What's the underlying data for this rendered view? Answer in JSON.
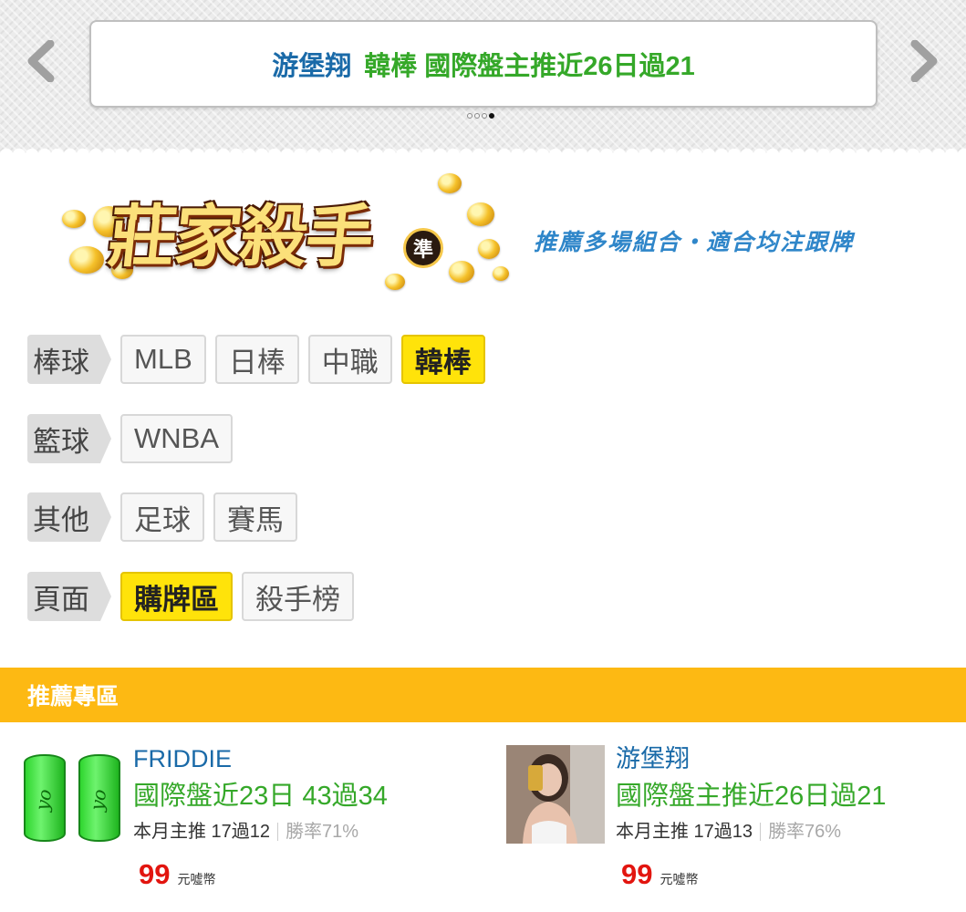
{
  "carousel": {
    "prev_icon": "chevron-left-icon",
    "next_icon": "chevron-right-icon",
    "banner_name": "游堡翔",
    "banner_text": "韓棒 國際盤主推近26日過21",
    "dot_count": 4,
    "active_dot": 3
  },
  "logo": {
    "title": "莊家殺手",
    "badge": "準",
    "tagline": "推薦多場組合・適合均注跟牌"
  },
  "categories": [
    {
      "label": "棒球",
      "items": [
        {
          "text": "MLB",
          "active": false
        },
        {
          "text": "日棒",
          "active": false
        },
        {
          "text": "中職",
          "active": false
        },
        {
          "text": "韓棒",
          "active": true
        }
      ]
    },
    {
      "label": "籃球",
      "items": [
        {
          "text": "WNBA",
          "active": false
        }
      ]
    },
    {
      "label": "其他",
      "items": [
        {
          "text": "足球",
          "active": false
        },
        {
          "text": "賽馬",
          "active": false
        }
      ]
    },
    {
      "label": "頁面",
      "items": [
        {
          "text": "購牌區",
          "active": true
        },
        {
          "text": "殺手榜",
          "active": false
        }
      ]
    }
  ],
  "section": {
    "title": "推薦專區"
  },
  "cards": [
    {
      "name": "FRIDDIE",
      "record": "國際盤近23日 43過34",
      "month": "本月主推 17過12",
      "rate": "勝率71%",
      "price": "99",
      "unit": "元噓幣",
      "avatar": "green-cans"
    },
    {
      "name": "游堡翔",
      "record": "國際盤主推近26日過21",
      "month": "本月主推 17過13",
      "rate": "勝率76%",
      "price": "99",
      "unit": "元噓幣",
      "avatar": "photo"
    }
  ],
  "colors": {
    "accent": "#fdb913",
    "active_chip": "#ffe30a",
    "name_blue": "#1a6aa8",
    "record_green": "#35a829",
    "price_red": "#e2150f"
  }
}
